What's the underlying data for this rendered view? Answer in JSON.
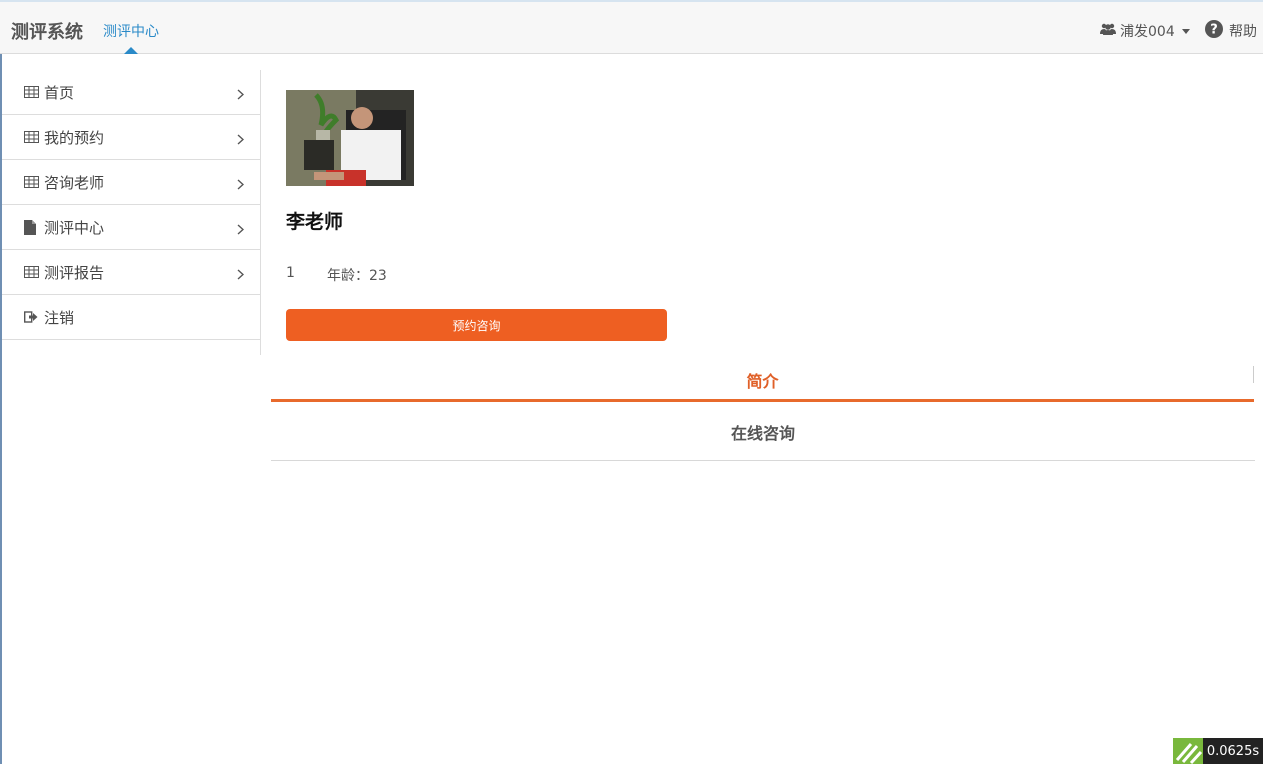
{
  "navbar": {
    "brand": "测评系统",
    "active_tab": "测评中心",
    "user_label": "浦发004",
    "help_label": "帮助"
  },
  "sidebar": {
    "items": [
      {
        "label": "首页",
        "icon": "table-icon",
        "chevron": true
      },
      {
        "label": "我的预约",
        "icon": "table-icon",
        "chevron": true
      },
      {
        "label": "咨询老师",
        "icon": "table-icon",
        "chevron": true
      },
      {
        "label": "测评中心",
        "icon": "file-icon",
        "chevron": true
      },
      {
        "label": "测评报告",
        "icon": "table-icon",
        "chevron": true
      },
      {
        "label": "注销",
        "icon": "sign-out-icon",
        "chevron": false
      }
    ]
  },
  "teacher": {
    "name": "李老师",
    "number": "1",
    "age_label": "年龄：23",
    "book_button": "预约咨询"
  },
  "tabs": {
    "intro": "简介",
    "online": "在线咨询"
  },
  "timer": {
    "value": "0.0625s"
  },
  "colors": {
    "accent": "#ee5f22",
    "nav_active": "#2a8ac8",
    "tab_active": "#e06028"
  }
}
